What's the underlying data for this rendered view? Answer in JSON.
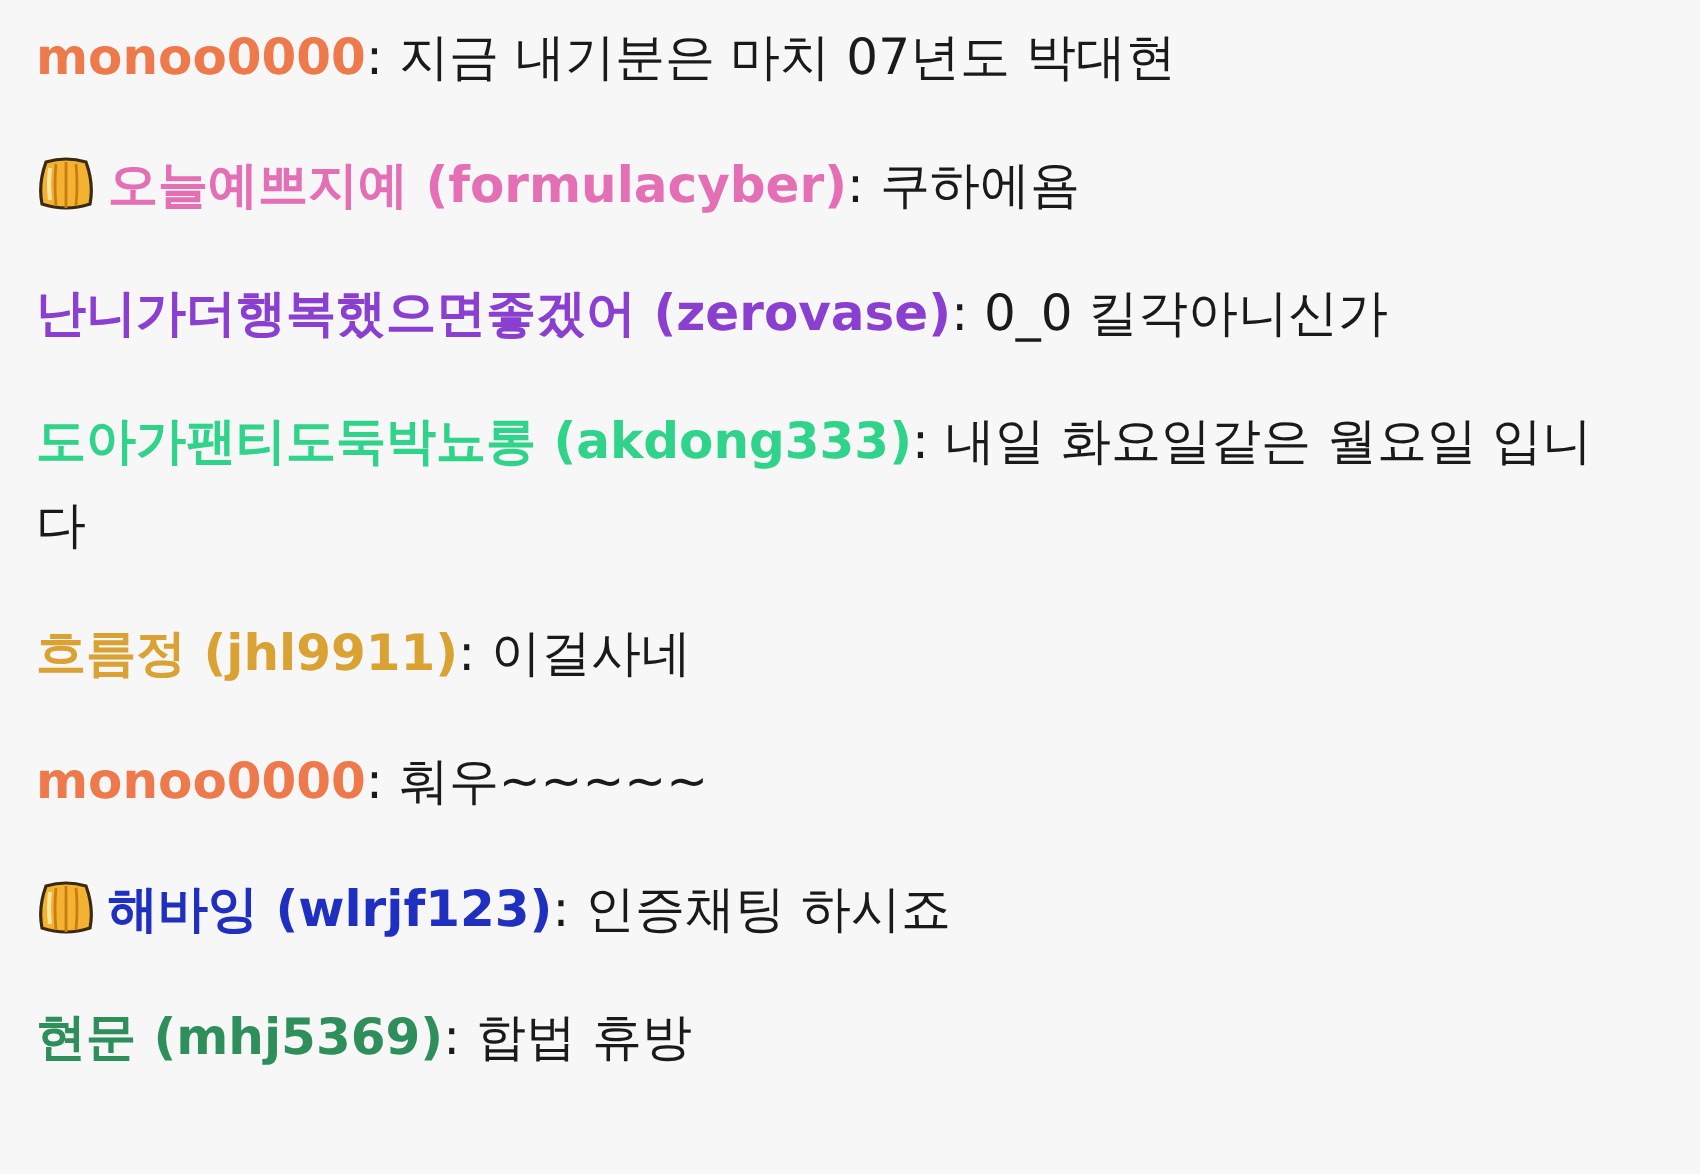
{
  "messages": [
    {
      "badge": false,
      "user": "monoo0000",
      "color": "#ee7a4c",
      "text": ": 지금 내기분은 마치 07년도 박대현"
    },
    {
      "badge": true,
      "user": "오늘예쁘지예 (formulacyber)",
      "color": "#e46fb4",
      "text": ": 쿠하에욤"
    },
    {
      "badge": false,
      "user": "난니가더행복했으면좋겠어 (zerovase)",
      "color": "#8a3fd0",
      "text": ": 0_0 킬각아니신가"
    },
    {
      "badge": false,
      "user": "도아가팬티도둑박뇨롱 (akdong333)",
      "color": "#2fd48a",
      "text": ": 내일 화요일같은 월요일 입니다"
    },
    {
      "badge": false,
      "user": "흐름정 (jhl9911)",
      "color": "#d9a232",
      "text": ": 이걸사네"
    },
    {
      "badge": false,
      "user": "monoo0000",
      "color": "#ee7a4c",
      "text": ": 훠우~~~~~"
    },
    {
      "badge": true,
      "user": "해바잉 (wlrjf123)",
      "color": "#1f2fbf",
      "text": ": 인증채팅 하시죠"
    },
    {
      "badge": false,
      "user": "현문 (mhj5369)",
      "color": "#2f8f5b",
      "text": ": 합법 휴방"
    }
  ]
}
